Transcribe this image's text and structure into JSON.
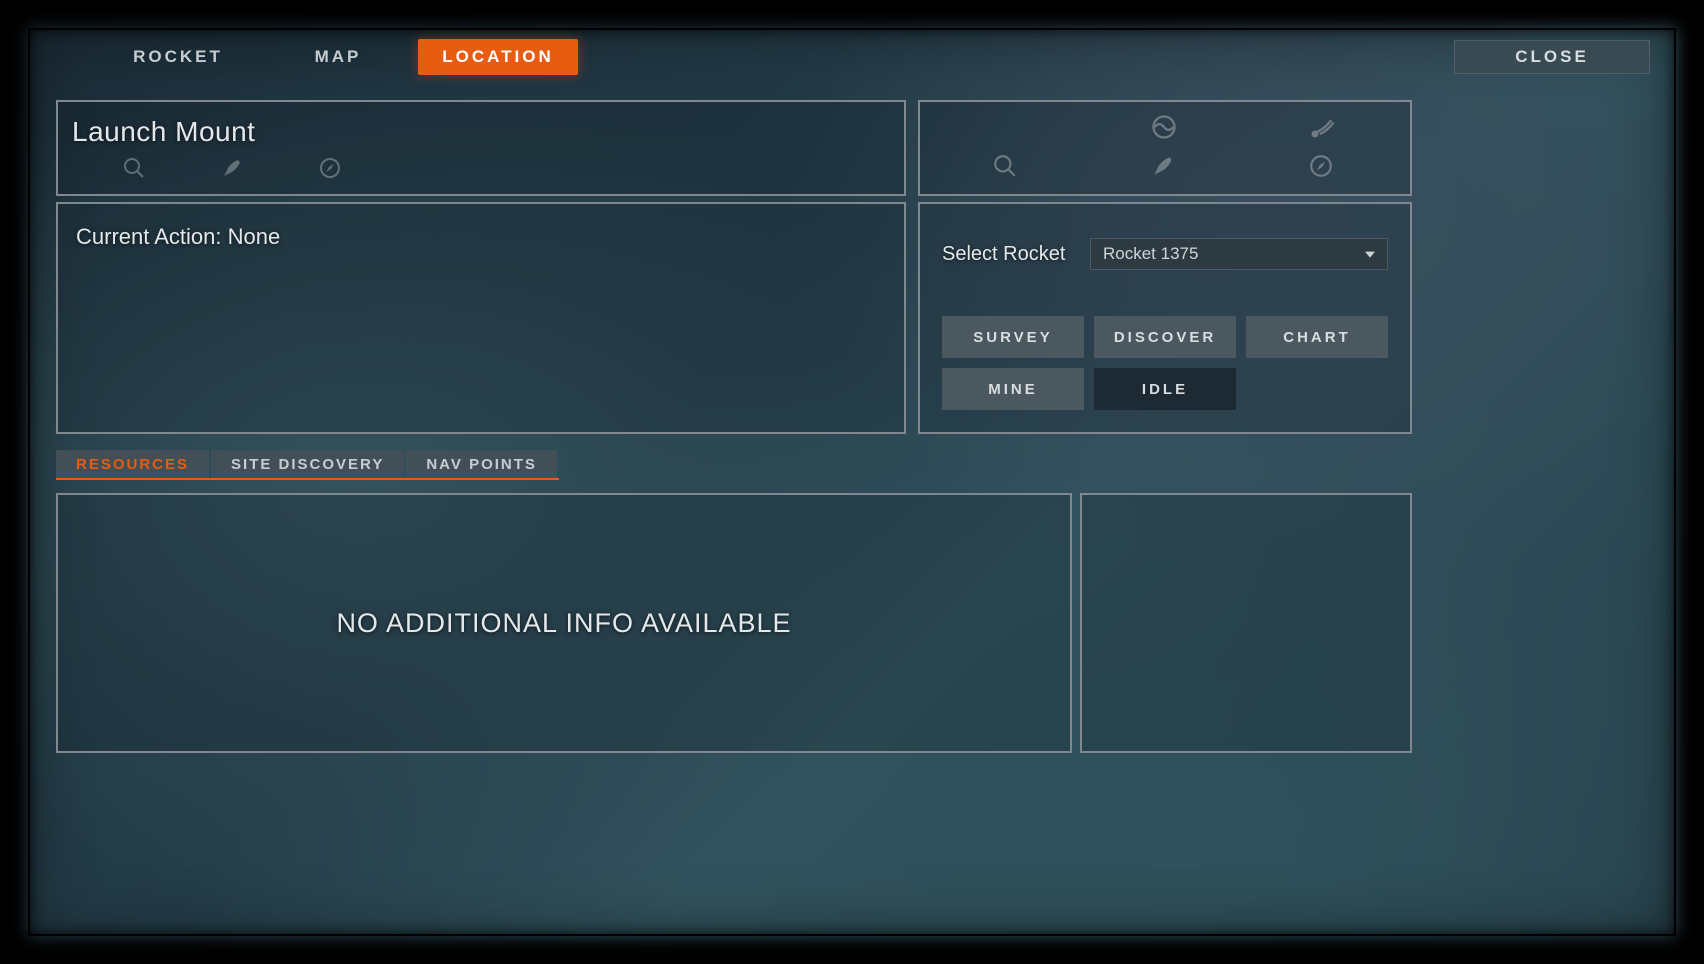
{
  "nav": {
    "tabs": [
      "ROCKET",
      "MAP",
      "LOCATION"
    ],
    "active_index": 2,
    "close": "CLOSE"
  },
  "location": {
    "title": "Launch Mount",
    "icons": [
      "magnifier-icon",
      "rocket-small-icon",
      "compass-icon"
    ]
  },
  "status_grid": {
    "icons": [
      null,
      "planet-icon",
      "satellite-icon",
      "magnifier-icon",
      "rocket-small-icon",
      "compass-icon"
    ]
  },
  "action_panel": {
    "current_action_label": "Current Action:",
    "current_action_value": "None"
  },
  "control_panel": {
    "select_label": "Select Rocket",
    "selected_rocket": "Rocket 1375",
    "buttons": [
      "SURVEY",
      "DISCOVER",
      "CHART",
      "MINE",
      "IDLE"
    ],
    "active_button_index": 4
  },
  "subtabs": {
    "items": [
      "RESOURCES",
      "SITE DISCOVERY",
      "NAV POINTS"
    ],
    "active_index": 0
  },
  "info_panel": {
    "message": "NO ADDITIONAL INFO AVAILABLE"
  }
}
